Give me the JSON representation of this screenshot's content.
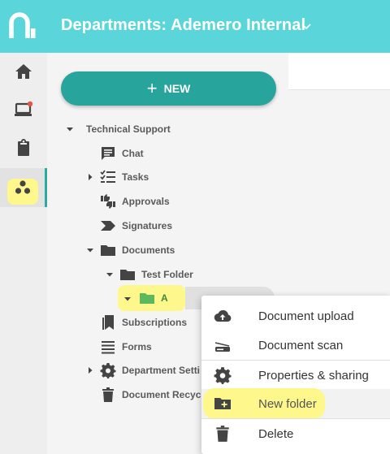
{
  "header": {
    "title": "Departments: Ademero Internal"
  },
  "rail": {
    "items": [
      {
        "icon": "home-icon"
      },
      {
        "icon": "computer-notification-icon"
      },
      {
        "icon": "clipboard-icon"
      },
      {
        "icon": "departments-icon"
      }
    ]
  },
  "toolbar": {
    "new_label": "NEW"
  },
  "tree": {
    "root": "Technical Support",
    "chat": "Chat",
    "tasks": "Tasks",
    "approvals": "Approvals",
    "signatures": "Signatures",
    "documents": "Documents",
    "test_folder": "Test Folder",
    "folder_a": "A",
    "subscriptions": "Subscriptions",
    "forms": "Forms",
    "department_settings": "Department Setti",
    "document_recycle": "Document Recyc"
  },
  "context_menu": {
    "document_upload": "Document upload",
    "document_scan": "Document scan",
    "properties_sharing": "Properties & sharing",
    "new_folder": "New folder",
    "delete": "Delete"
  },
  "colors": {
    "header": "#5ad6db",
    "accent": "#27a59c",
    "highlight": "#fdf78c",
    "folder_green": "#5cb85c",
    "notification_red": "#e05545"
  }
}
